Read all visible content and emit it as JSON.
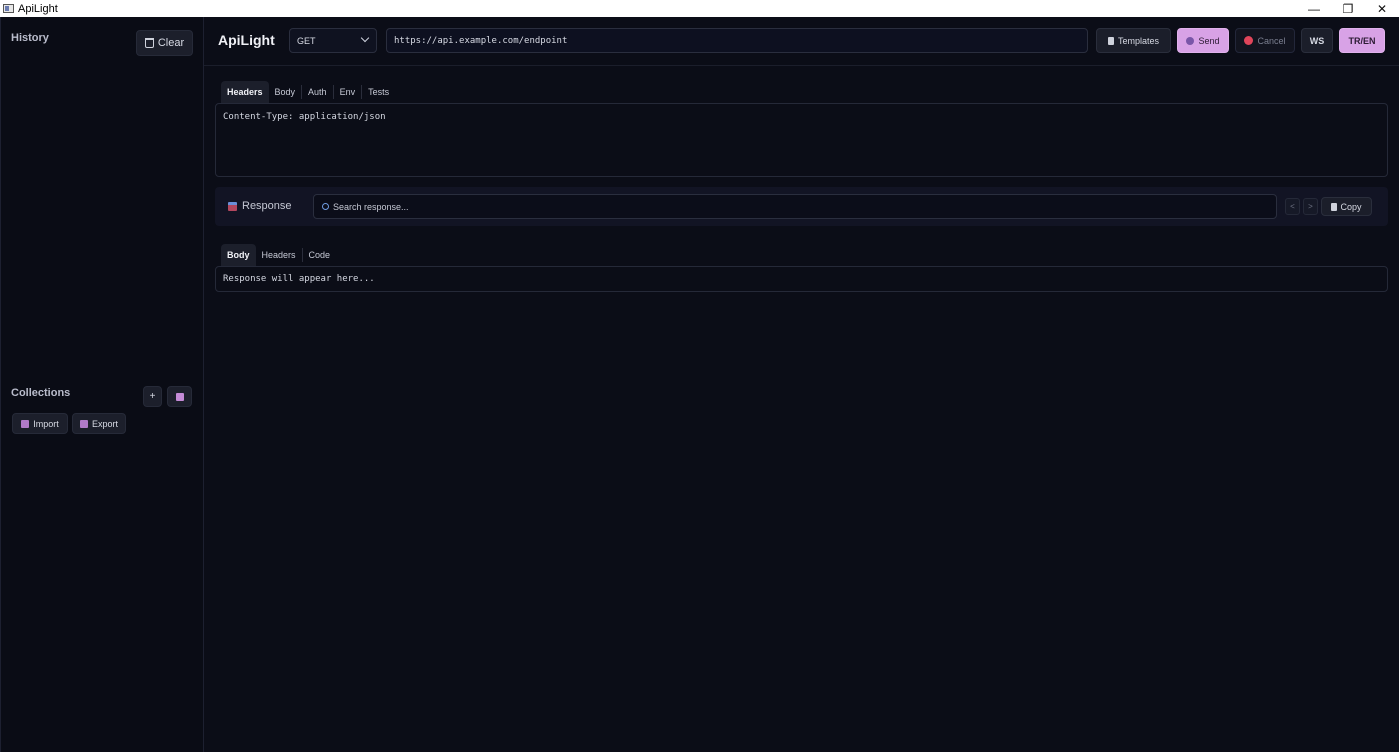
{
  "window": {
    "title": "ApiLight",
    "minimize": "—",
    "maximize": "❐",
    "close": "✕"
  },
  "sidebar": {
    "history_heading": "History",
    "clear_label": "Clear",
    "collections_heading": "Collections",
    "add_label": "+",
    "import_label": "Import",
    "export_label": "Export"
  },
  "header": {
    "brand": "ApiLight",
    "method": "GET",
    "url": "https://api.example.com/endpoint",
    "templates_label": "Templates",
    "send_label": "Send",
    "cancel_label": "Cancel",
    "ws_label": "WS",
    "lang_label": "TR/EN"
  },
  "request": {
    "tabs": [
      "Headers",
      "Body",
      "Auth",
      "Env",
      "Tests"
    ],
    "active_tab": "Headers",
    "headers_text": "Content-Type: application/json"
  },
  "response": {
    "title": "Response",
    "search_placeholder": "Search response...",
    "prev_label": "<",
    "next_label": ">",
    "copy_label": "Copy",
    "tabs": [
      "Body",
      "Headers",
      "Code"
    ],
    "active_tab": "Body",
    "body_text": "Response will appear here..."
  },
  "colors": {
    "accent_pink": "#d8a2e6",
    "background": "#0b0d17",
    "panel_border": "#252938"
  }
}
